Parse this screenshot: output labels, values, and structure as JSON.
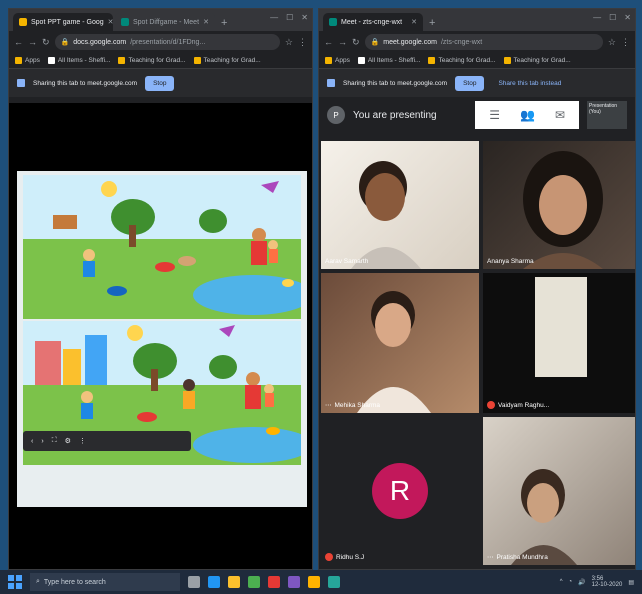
{
  "left_window": {
    "tabs": [
      {
        "label": "Spot PPT game - Goog",
        "active": true
      },
      {
        "label": "Spot Diffgame - Meet",
        "active": false
      }
    ],
    "url_host": "docs.google.com",
    "url_path": "/presentation/d/1FDng...",
    "bookmarks": [
      "Apps",
      "All Items - Sheffi...",
      "Teaching for Grad...",
      "Teaching for Grad..."
    ],
    "share_text": "Sharing this tab to meet.google.com",
    "share_stop": "Stop"
  },
  "right_window": {
    "tabs": [
      {
        "label": "Meet - zts-cnge-wxt",
        "active": true
      }
    ],
    "url_host": "meet.google.com",
    "url_path": "/zts-cnge-wxt",
    "bookmarks": [
      "Apps",
      "All Items - Sheffi...",
      "Teaching for Grad...",
      "Teaching for Grad..."
    ],
    "share_text": "Sharing this tab to meet.google.com",
    "share_stop": "Stop",
    "share_this": "Share this tab instead",
    "presenting_text": "You are presenting",
    "avatar_letter": "P",
    "mini_label": "Presentation (You)",
    "participants": [
      {
        "name": "Aarav Samarth"
      },
      {
        "name": "Ananya Sharma"
      },
      {
        "name": "Mehika Sharma"
      },
      {
        "name": "Vaidyam Raghu..."
      },
      {
        "name": "Ridhu S.J",
        "letter": "R"
      },
      {
        "name": "Pratisha Mundhra"
      }
    ]
  },
  "taskbar": {
    "search_placeholder": "Type here to search",
    "time": "3:56",
    "date": "12-10-2020"
  }
}
